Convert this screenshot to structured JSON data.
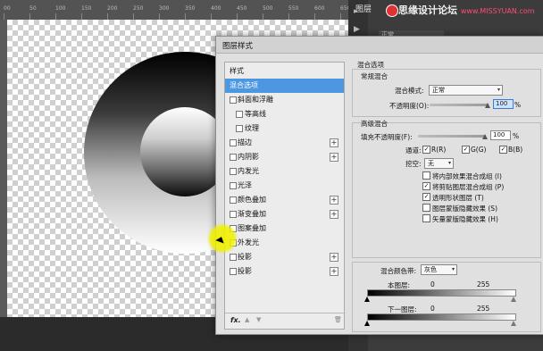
{
  "app": {
    "ruler_ticks": [
      "00",
      "50",
      "100",
      "150",
      "200",
      "250",
      "300",
      "350",
      "400",
      "450",
      "500",
      "550",
      "600",
      "650"
    ],
    "panel_title": "图层",
    "panel_mode": "正常",
    "watermark": "思缘设计论坛",
    "watermark_url": "www.MISSYUAN.com",
    "icons": [
      "play-icon",
      "layers-icon",
      "logo-icon"
    ]
  },
  "dialog": {
    "title": "图层样式",
    "styles_header": "样式",
    "items": [
      {
        "label": "混合选项",
        "selected": true,
        "checkbox": false,
        "plus": false,
        "sub": false
      },
      {
        "label": "斜面和浮雕",
        "checkbox": true,
        "plus": false,
        "sub": false
      },
      {
        "label": "等高线",
        "checkbox": true,
        "plus": false,
        "sub": true
      },
      {
        "label": "纹理",
        "checkbox": true,
        "plus": false,
        "sub": true
      },
      {
        "label": "描边",
        "checkbox": true,
        "plus": true,
        "sub": false
      },
      {
        "label": "内阴影",
        "checkbox": true,
        "plus": true,
        "sub": false
      },
      {
        "label": "内发光",
        "checkbox": true,
        "plus": false,
        "sub": false
      },
      {
        "label": "光泽",
        "checkbox": true,
        "plus": false,
        "sub": false
      },
      {
        "label": "颜色叠加",
        "checkbox": true,
        "plus": true,
        "sub": false
      },
      {
        "label": "渐变叠加",
        "checkbox": true,
        "plus": true,
        "sub": false
      },
      {
        "label": "图案叠加",
        "checkbox": true,
        "plus": false,
        "sub": false
      },
      {
        "label": "外发光",
        "checkbox": true,
        "plus": false,
        "sub": false
      },
      {
        "label": "投影",
        "checkbox": true,
        "plus": true,
        "sub": false
      },
      {
        "label": "投影",
        "checkbox": true,
        "plus": true,
        "sub": false
      }
    ],
    "footer": {
      "fx": "fx.",
      "up": "▲",
      "down": "▼",
      "trash": "🗑"
    },
    "blend_options": "混合选项",
    "general_blending": "常规混合",
    "blend_mode_label": "混合模式:",
    "blend_mode_value": "正常",
    "opacity_label": "不透明度(O):",
    "opacity_value": "100",
    "percent": "%",
    "advanced_blending": "高级混合",
    "fill_opacity_label": "填充不透明度(F):",
    "fill_opacity_value": "100",
    "channels_label": "通道:",
    "channel_r": "R(R)",
    "channel_g": "G(G)",
    "channel_b": "B(B)",
    "knockout_label": "挖空:",
    "knockout_value": "无",
    "options": [
      {
        "label": "将内部效果混合成组 (I)",
        "checked": false
      },
      {
        "label": "将剪贴图层混合成组 (P)",
        "checked": true
      },
      {
        "label": "透明形状图层 (T)",
        "checked": true
      },
      {
        "label": "图层蒙版隐藏效果 (S)",
        "checked": false
      },
      {
        "label": "矢量蒙版隐藏效果 (H)",
        "checked": false
      }
    ],
    "blend_if_label": "混合颜色带:",
    "blend_if_value": "灰色",
    "this_layer_label": "本图层:",
    "this_layer_min": "0",
    "this_layer_max": "255",
    "underlying_label": "下一图层:",
    "underlying_min": "0",
    "underlying_max": "255"
  }
}
